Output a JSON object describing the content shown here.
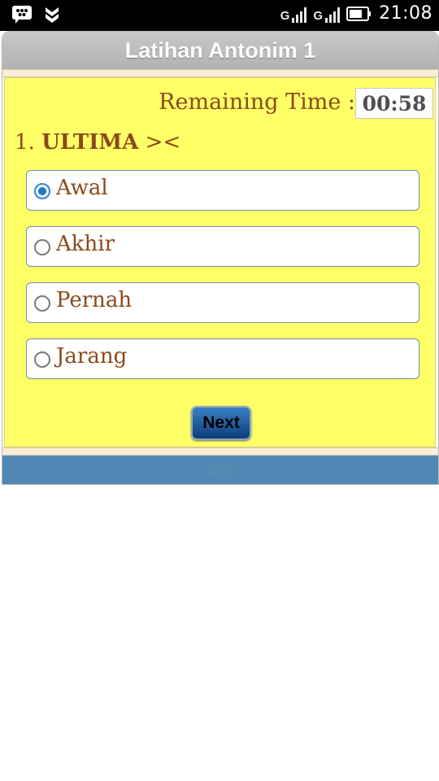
{
  "status_bar": {
    "time": "21:08",
    "signal_label_1": "G",
    "signal_label_2": "G",
    "icons": [
      "bbm-chat-icon",
      "notification-chevron-icon",
      "signal-icon",
      "signal-icon",
      "battery-icon"
    ]
  },
  "app": {
    "title": "Latihan Antonim 1"
  },
  "timer": {
    "label": "Remaining Time :",
    "value": "00:58"
  },
  "question": {
    "number": "1.",
    "word": "ULTIMA",
    "suffix": "><"
  },
  "options": [
    {
      "label": "Awal",
      "checked": true
    },
    {
      "label": "Akhir",
      "checked": false
    },
    {
      "label": "Pernah",
      "checked": false
    },
    {
      "label": "Jarang",
      "checked": false
    }
  ],
  "buttons": {
    "next_label": "Next"
  },
  "footer": {
    "text": "Erq\""
  },
  "colors": {
    "content_bg": "#ffff66",
    "text_brown": "#8b4a1b",
    "footer_bg": "#4f88b2",
    "button_blue": "#0d3d78"
  }
}
